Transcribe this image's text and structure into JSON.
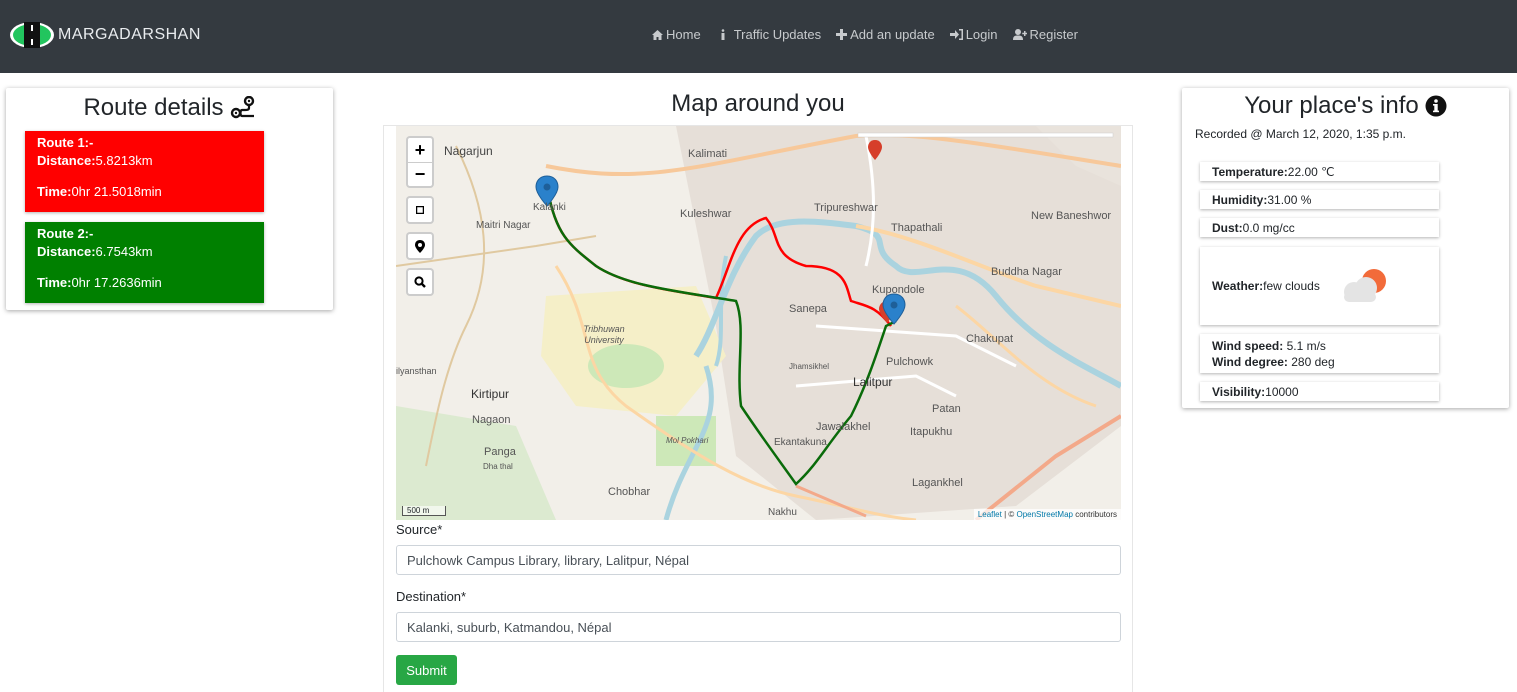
{
  "nav": {
    "brand": "MARGADARSHAN",
    "items": [
      {
        "label": "Home",
        "icon": "home-icon"
      },
      {
        "label": "Traffic Updates",
        "icon": "info-icon"
      },
      {
        "label": "Add an update",
        "icon": "plus-icon"
      },
      {
        "label": "Login",
        "icon": "sign-in-icon"
      },
      {
        "label": "Register",
        "icon": "user-plus-icon"
      }
    ]
  },
  "routes": {
    "title": "Route details",
    "items": [
      {
        "name": "Route 1:-",
        "distance_label": "Distance:",
        "distance": "5.8213km",
        "time_label": "Time:",
        "time": "0hr 21.5018min",
        "color": "#ff0000"
      },
      {
        "name": "Route 2:-",
        "distance_label": "Distance:",
        "distance": "6.7543km",
        "time_label": "Time:",
        "time": "0hr 17.2636min",
        "color": "#008000"
      }
    ]
  },
  "map": {
    "title": "Map around you",
    "zoom_in": "+",
    "zoom_out": "−",
    "scale": "500 m",
    "attribution_leaflet": "Leaflet",
    "attribution_sep": " | © ",
    "attribution_osm": "OpenStreetMap",
    "attribution_tail": " contributors",
    "labels": [
      "Nagarjun",
      "Kalimati",
      "Kalanki",
      "Kuleshwar",
      "Tripureshwar",
      "Thapathali",
      "New Baneshwor",
      "Maitri Nagar",
      "Buddha Nagar",
      "Kupondole",
      "Sanepa",
      "Chakupat",
      "Tribhuwan University",
      "Pulchowk",
      "Jhamsikhel",
      "Lalitpur",
      "Kirtipur",
      "Patan",
      "Nagaon",
      "Jawalakhel",
      "Itapukhu",
      "Panga",
      "Ekantakuna",
      "Chobhar",
      "Lagankhel",
      "Nakhu",
      "Dha thal",
      "ilyansthan",
      "Mol Pokhari"
    ]
  },
  "form": {
    "source_label": "Source*",
    "source_value": "Pulchowk Campus Library, library, Lalitpur, Népal",
    "destination_label": "Destination*",
    "destination_value": "Kalanki, suburb, Katmandou, Népal",
    "submit": "Submit"
  },
  "info": {
    "title": "Your place's info",
    "recorded": "Recorded @ March 12, 2020, 1:35 p.m.",
    "temperature_label": "Temperature:",
    "temperature": "22.00 ℃",
    "humidity_label": "Humidity:",
    "humidity": "31.00 %",
    "dust_label": "Dust:",
    "dust": "0.0 mg/cc",
    "weather_label": "Weather:",
    "weather": "few clouds",
    "wind_speed_label": "Wind speed:",
    "wind_speed": " 5.1 m/s",
    "wind_degree_label": "Wind degree:",
    "wind_degree": " 280 deg",
    "visibility_label": "Visibility:",
    "visibility": " 10000"
  }
}
